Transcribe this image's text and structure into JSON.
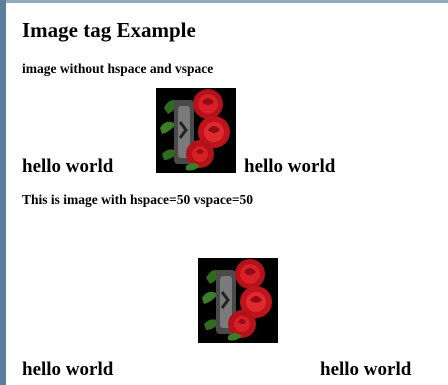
{
  "page": {
    "title": "Image tag Example",
    "section1_heading": "image without hspace and vspace",
    "section2_heading": "This is image with hspace=50 vspace=50"
  },
  "row1": {
    "left_text": "hello world",
    "right_text": "hello world"
  },
  "row2": {
    "left_text": "hello world",
    "right_text": "hello world"
  },
  "colors": {
    "frame": "#5b7f9e",
    "rose": "#c0141c",
    "leaf": "#2f6b1e",
    "image_background": "#000000"
  },
  "icons": {
    "image1": "rose-flower-image",
    "image2": "rose-flower-image"
  }
}
